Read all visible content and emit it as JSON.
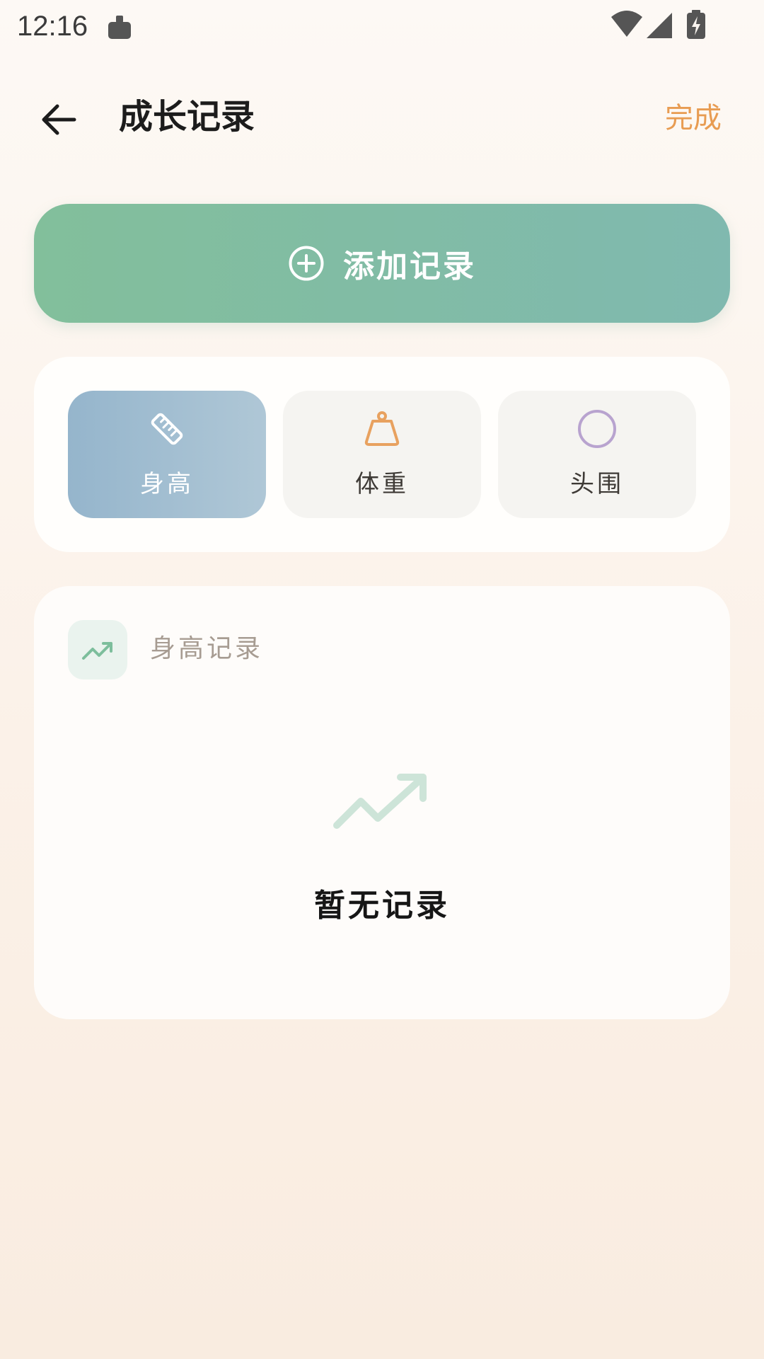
{
  "status_bar": {
    "time": "12:16",
    "notification_icon": "android-debug-icon",
    "wifi_icon": "wifi-icon",
    "signal_icon": "cell-signal-icon",
    "battery_icon": "battery-charging-icon"
  },
  "header": {
    "back_icon": "arrow-left-icon",
    "title": "成长记录",
    "done_label": "完成"
  },
  "add_record": {
    "icon": "plus-circle-icon",
    "label": "添加记录"
  },
  "record_types": [
    {
      "label": "身高",
      "icon": "ruler-icon",
      "selected": true
    },
    {
      "label": "体重",
      "icon": "weight-icon",
      "selected": false
    },
    {
      "label": "头围",
      "icon": "circle-icon",
      "selected": false
    }
  ],
  "records": {
    "icon": "trending-up-icon",
    "title": "身高记录",
    "empty_icon": "trending-up-icon",
    "empty_text": "暂无记录"
  },
  "colors": {
    "accent_orange": "#E89C52",
    "add_button_start": "#82BF9B",
    "add_button_end": "#80B9AF",
    "active_type_start": "#95B5CC",
    "weight_icon": "#E8A15F",
    "head_icon": "#B8A3CF",
    "trend_icon": "#7DBE9C"
  }
}
